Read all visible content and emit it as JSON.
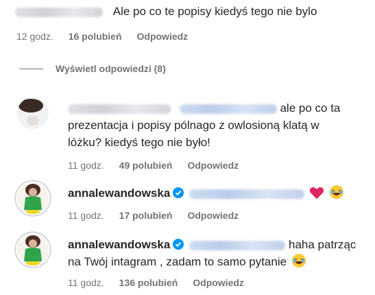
{
  "comment1": {
    "text": "Ale po co te popisy kiedyś tego nie bylo",
    "time": "12 godz.",
    "likes": "16 polubień",
    "reply": "Odpowiedz"
  },
  "view_replies": "Wyświetl odpowiedzi (8)",
  "reply1": {
    "text_line1": "ale po co ta",
    "text_line2": "prezentacja i popisy pólnago z owlosioną klatą w",
    "text_line3": "lóżku? kiedyś tego nie było!",
    "time": "11 godz.",
    "likes": "49 polubień",
    "reply": "Odpowiedz"
  },
  "reply2": {
    "username": "annalewandowska",
    "time": "11 godz.",
    "likes": "17 polubień",
    "reply": "Odpowiedz"
  },
  "reply3": {
    "username": "annalewandowska",
    "text_line1": "haha patrząc",
    "text_line2": "na Twój intagram , zadam to samo pytanie",
    "time": "11 godz.",
    "likes": "136 polubień",
    "reply": "Odpowiedz"
  },
  "colors": {
    "text": "#262626",
    "meta": "#737373",
    "verified": "#0095f6",
    "heart": "#e0245e"
  },
  "icons": [
    "verified-badge-icon",
    "red-heart-emoji-icon",
    "laughing-emoji-icon",
    "avatar-image"
  ]
}
